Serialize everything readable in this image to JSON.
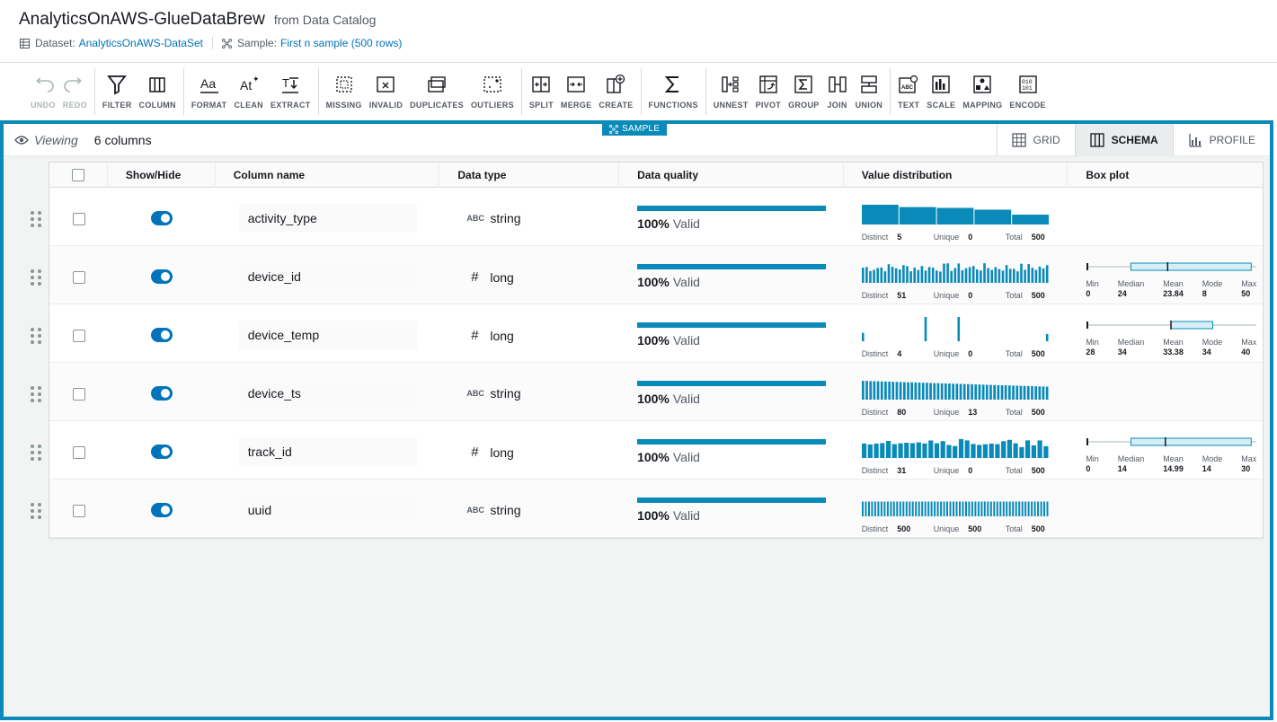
{
  "header": {
    "title": "AnalyticsOnAWS-GlueDataBrew",
    "subtitle": "from Data Catalog",
    "dataset_label": "Dataset:",
    "dataset_value": "AnalyticsOnAWS-DataSet",
    "sample_label": "Sample:",
    "sample_value": "First n sample (500 rows)"
  },
  "toolbar": {
    "undo": "UNDO",
    "redo": "REDO",
    "filter": "FILTER",
    "column": "COLUMN",
    "format": "FORMAT",
    "clean": "CLEAN",
    "extract": "EXTRACT",
    "missing": "MISSING",
    "invalid": "INVALID",
    "duplicates": "DUPLICATES",
    "outliers": "OUTLIERS",
    "split": "SPLIT",
    "merge": "MERGE",
    "create": "CREATE",
    "functions": "FUNCTIONS",
    "unnest": "UNNEST",
    "pivot": "PIVOT",
    "group": "GROUP",
    "join": "JOIN",
    "union": "UNION",
    "text": "TEXT",
    "scale": "SCALE",
    "mapping": "MAPPING",
    "encode": "ENCODE"
  },
  "view": {
    "sample_tag": "SAMPLE",
    "viewing": "Viewing",
    "columns_count": "6 columns",
    "tabs": {
      "grid": "GRID",
      "schema": "SCHEMA",
      "profile": "PROFILE"
    }
  },
  "table": {
    "headers": {
      "show_hide": "Show/Hide",
      "column_name": "Column name",
      "data_type": "Data type",
      "data_quality": "Data quality",
      "value_distribution": "Value distribution",
      "box_plot": "Box plot"
    },
    "valid_pct": "100%",
    "valid_label": "Valid",
    "stat_labels": {
      "distinct": "Distinct",
      "unique": "Unique",
      "total": "Total",
      "min": "Min",
      "median": "Median",
      "mean": "Mean",
      "mode": "Mode",
      "max": "Max"
    },
    "rows": [
      {
        "name": "activity_type",
        "type_icon": "ABC",
        "type": "string",
        "distinct": "5",
        "unique": "0",
        "total": "500",
        "dist": "cat5"
      },
      {
        "name": "device_id",
        "type_icon": "#",
        "type": "long",
        "distinct": "51",
        "unique": "0",
        "total": "500",
        "dist": "many",
        "box": {
          "min": "0",
          "median": "24",
          "mean": "23.84",
          "mode": "8",
          "max": "50"
        }
      },
      {
        "name": "device_temp",
        "type_icon": "#",
        "type": "long",
        "distinct": "4",
        "unique": "0",
        "total": "500",
        "dist": "sparse",
        "box": {
          "min": "28",
          "median": "34",
          "mean": "33.38",
          "mode": "34",
          "max": "40"
        }
      },
      {
        "name": "device_ts",
        "type_icon": "ABC",
        "type": "string",
        "distinct": "80",
        "unique": "13",
        "total": "500",
        "dist": "decline"
      },
      {
        "name": "track_id",
        "type_icon": "#",
        "type": "long",
        "distinct": "31",
        "unique": "0",
        "total": "500",
        "dist": "gappy",
        "box": {
          "min": "0",
          "median": "14",
          "mean": "14.99",
          "mode": "14",
          "max": "30"
        }
      },
      {
        "name": "uuid",
        "type_icon": "ABC",
        "type": "string",
        "distinct": "500",
        "unique": "500",
        "total": "500",
        "dist": "uniform"
      }
    ]
  },
  "colors": {
    "accent": "#0a8ab8",
    "toggle": "#0073bb",
    "link": "#0073bb"
  }
}
